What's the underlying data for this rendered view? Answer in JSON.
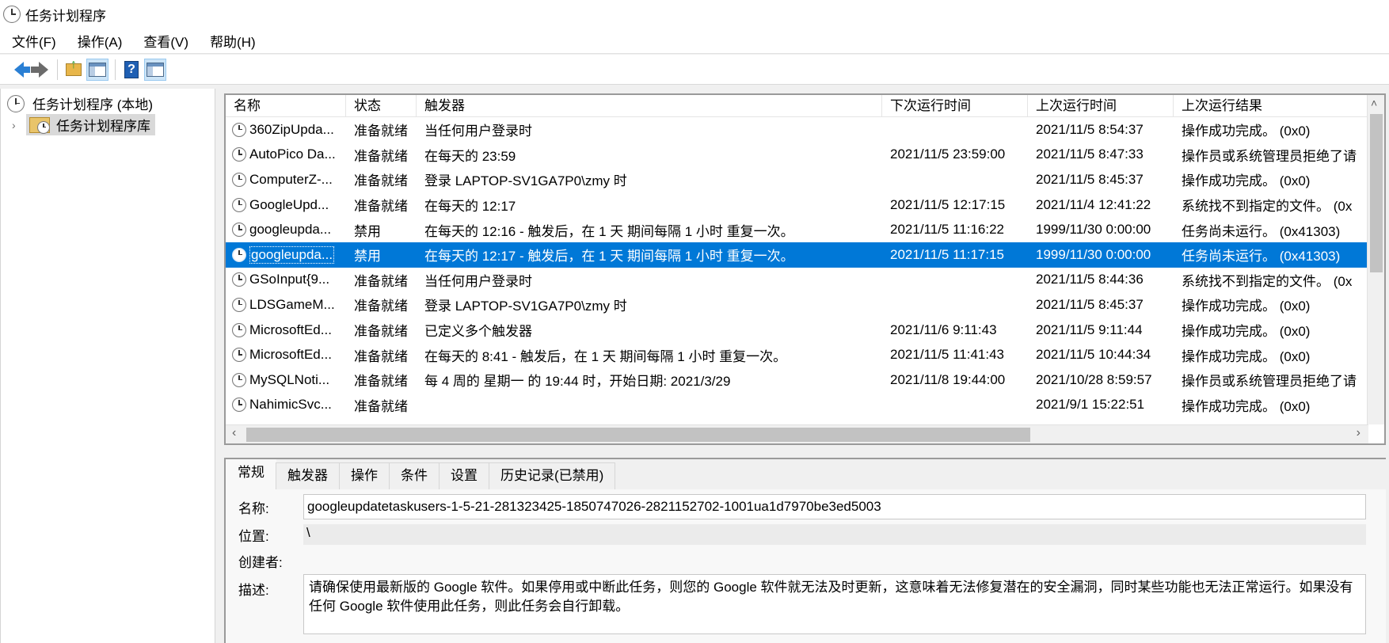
{
  "window": {
    "title": "任务计划程序"
  },
  "menu": [
    "文件(F)",
    "操作(A)",
    "查看(V)",
    "帮助(H)"
  ],
  "toolbar": {
    "buttons": [
      {
        "name": "back-button",
        "icon": "arrow-left-icon"
      },
      {
        "name": "forward-button",
        "icon": "arrow-right-icon"
      },
      {
        "name": "up-folder-button",
        "icon": "folder-up-icon"
      },
      {
        "name": "show-console-tree-button",
        "icon": "panel-icon"
      },
      {
        "name": "help-button",
        "icon": "help-icon"
      },
      {
        "name": "show-action-pane-button",
        "icon": "panel-icon"
      }
    ]
  },
  "tree": {
    "root": "任务计划程序 (本地)",
    "child": "任务计划程序库"
  },
  "table": {
    "headers": [
      "名称",
      "状态",
      "触发器",
      "下次运行时间",
      "上次运行时间",
      "上次运行结果"
    ],
    "rows": [
      {
        "name": "360ZipUpda...",
        "status": "准备就绪",
        "trigger": "当任何用户登录时",
        "next": "",
        "last": "2021/11/5 8:54:37",
        "result": "操作成功完成。 (0x0)"
      },
      {
        "name": "AutoPico Da...",
        "status": "准备就绪",
        "trigger": "在每天的 23:59",
        "next": "2021/11/5 23:59:00",
        "last": "2021/11/5 8:47:33",
        "result": "操作员或系统管理员拒绝了请"
      },
      {
        "name": "ComputerZ-...",
        "status": "准备就绪",
        "trigger": "登录 LAPTOP-SV1GA7P0\\zmy 时",
        "next": "",
        "last": "2021/11/5 8:45:37",
        "result": "操作成功完成。 (0x0)"
      },
      {
        "name": "GoogleUpd...",
        "status": "准备就绪",
        "trigger": "在每天的 12:17",
        "next": "2021/11/5 12:17:15",
        "last": "2021/11/4 12:41:22",
        "result": "系统找不到指定的文件。 (0x"
      },
      {
        "name": "googleupda...",
        "status": "禁用",
        "trigger": "在每天的 12:16 - 触发后，在 1 天 期间每隔 1 小时 重复一次。",
        "next": "2021/11/5 11:16:22",
        "last": "1999/11/30 0:00:00",
        "result": "任务尚未运行。 (0x41303)"
      },
      {
        "name": "googleupda...",
        "status": "禁用",
        "trigger": "在每天的 12:17 - 触发后，在 1 天 期间每隔 1 小时 重复一次。",
        "next": "2021/11/5 11:17:15",
        "last": "1999/11/30 0:00:00",
        "result": "任务尚未运行。 (0x41303)",
        "selected": true
      },
      {
        "name": "GSoInput{9...",
        "status": "准备就绪",
        "trigger": "当任何用户登录时",
        "next": "",
        "last": "2021/11/5 8:44:36",
        "result": "系统找不到指定的文件。 (0x"
      },
      {
        "name": "LDSGameM...",
        "status": "准备就绪",
        "trigger": "登录 LAPTOP-SV1GA7P0\\zmy 时",
        "next": "",
        "last": "2021/11/5 8:45:37",
        "result": "操作成功完成。 (0x0)"
      },
      {
        "name": "MicrosoftEd...",
        "status": "准备就绪",
        "trigger": "已定义多个触发器",
        "next": "2021/11/6 9:11:43",
        "last": "2021/11/5 9:11:44",
        "result": "操作成功完成。 (0x0)"
      },
      {
        "name": "MicrosoftEd...",
        "status": "准备就绪",
        "trigger": "在每天的 8:41 - 触发后，在 1 天 期间每隔 1 小时 重复一次。",
        "next": "2021/11/5 11:41:43",
        "last": "2021/11/5 10:44:34",
        "result": "操作成功完成。 (0x0)"
      },
      {
        "name": "MySQLNoti...",
        "status": "准备就绪",
        "trigger": "每 4 周的 星期一 的 19:44 时，开始日期: 2021/3/29",
        "next": "2021/11/8 19:44:00",
        "last": "2021/10/28 8:59:57",
        "result": "操作员或系统管理员拒绝了请"
      },
      {
        "name": "NahimicSvc...",
        "status": "准备就绪",
        "trigger": "",
        "next": "",
        "last": "2021/9/1 15:22:51",
        "result": "操作成功完成。 (0x0)"
      }
    ]
  },
  "details": {
    "tabs": [
      "常规",
      "触发器",
      "操作",
      "条件",
      "设置",
      "历史记录(已禁用)"
    ],
    "active_tab": "常规",
    "name_label": "名称:",
    "name_value": "googleupdatetaskusers-1-5-21-281323425-1850747026-2821152702-1001ua1d7970be3ed5003",
    "location_label": "位置:",
    "location_value": "\\",
    "author_label": "创建者:",
    "author_value": "",
    "description_label": "描述:",
    "description_value": "请确保使用最新版的 Google 软件。如果停用或中断此任务，则您的 Google 软件就无法及时更新，这意味着无法修复潜在的安全漏洞，同时某些功能也无法正常运行。如果没有任何 Google 软件使用此任务，则此任务会自行卸载。"
  },
  "colors": {
    "selection": "#0078d7",
    "pane_border": "#9a9a9a"
  }
}
